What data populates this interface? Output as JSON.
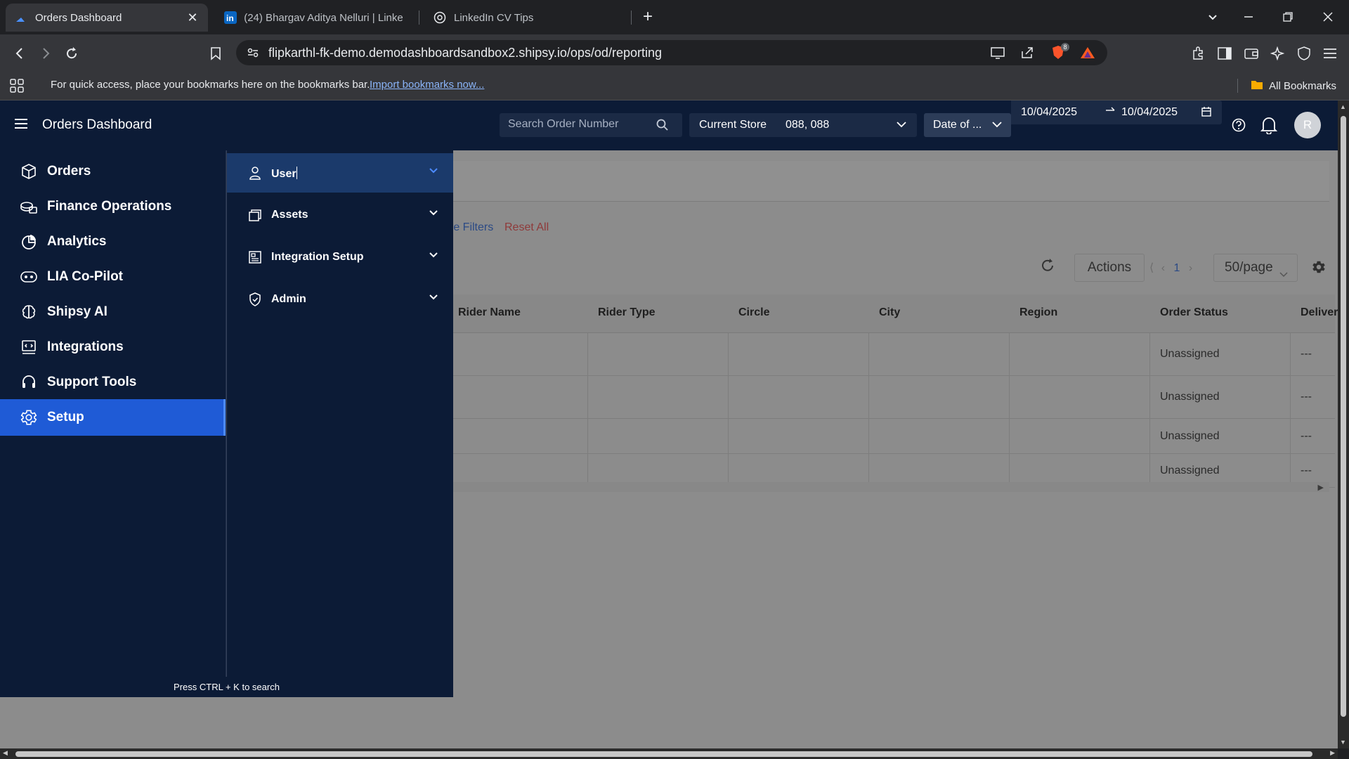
{
  "browser": {
    "tabs": [
      {
        "title": "Orders Dashboard",
        "active": true
      },
      {
        "title": "(24) Bhargav Aditya Nelluri | LinkedI",
        "active": false
      },
      {
        "title": "LinkedIn CV Tips",
        "active": false
      }
    ],
    "url": "flipkarthl-fk-demo.demodashboardsandbox2.shipsy.io/ops/od/reporting",
    "bookmarks_bar": {
      "message": "For quick access, place your bookmarks here on the bookmarks bar.",
      "import_link": "Import bookmarks now...",
      "all_bookmarks": "All Bookmarks"
    },
    "brave_badge": "8"
  },
  "app": {
    "title": "Orders Dashboard",
    "search": {
      "placeholder": "Search Order Number"
    },
    "store": {
      "label": "Current Store",
      "value": "088, 088"
    },
    "date_type": "Date of ...",
    "date_from": "10/04/2025",
    "date_to": "10/04/2025",
    "avatar_initial": "R"
  },
  "sidebar": {
    "items": [
      {
        "label": "Orders",
        "icon": "box-icon"
      },
      {
        "label": "Finance Operations",
        "icon": "money-icon"
      },
      {
        "label": "Analytics",
        "icon": "pie-chart-icon"
      },
      {
        "label": "LIA Co-Pilot",
        "icon": "copilot-icon"
      },
      {
        "label": "Shipsy AI",
        "icon": "brain-icon"
      },
      {
        "label": "Integrations",
        "icon": "integrations-icon"
      },
      {
        "label": "Support Tools",
        "icon": "headset-icon"
      },
      {
        "label": "Setup",
        "icon": "gear-icon",
        "selected": true
      }
    ],
    "hint": "Press CTRL + K to search"
  },
  "setup_menu": {
    "items": [
      {
        "label": "User",
        "icon": "user-icon",
        "open": true
      },
      {
        "label": "Assets",
        "icon": "assets-icon"
      },
      {
        "label": "Integration Setup",
        "icon": "integration-setup-icon"
      },
      {
        "label": "Admin",
        "icon": "admin-shield-icon"
      }
    ]
  },
  "content": {
    "more_filters": "re Filters",
    "reset_all": "Reset All",
    "actions": "Actions",
    "page": "1",
    "per_page": "50/page",
    "columns": [
      "Rider Name",
      "Rider Type",
      "Circle",
      "City",
      "Region",
      "Order Status",
      "Deliver"
    ],
    "rows": [
      {
        "order_status": "Unassigned",
        "deliver": "---"
      },
      {
        "order_status": "Unassigned",
        "deliver": "---"
      },
      {
        "order_status": "Unassigned",
        "deliver": "---"
      },
      {
        "order_status": "Unassigned",
        "deliver": "---"
      }
    ]
  },
  "colors": {
    "nav_bg": "#0c1b36",
    "selected": "#1f5bd6",
    "submenu_open": "#1b3a6b"
  }
}
